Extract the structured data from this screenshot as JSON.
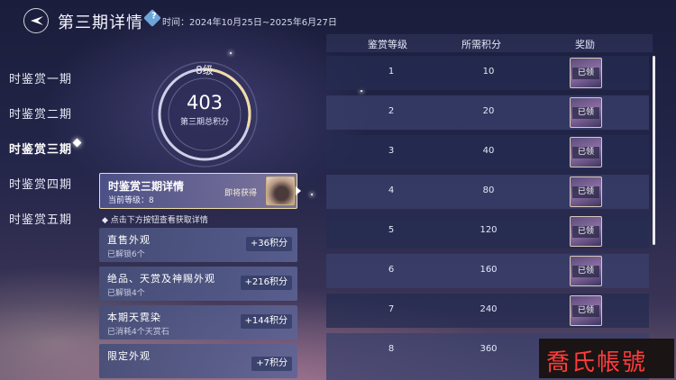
{
  "header": {
    "title": "第三期详情",
    "help_label": "?",
    "time": "时间：2024年10月25日~2025年6月27日"
  },
  "periods": [
    "时鉴赏一期",
    "时鉴赏二期",
    "时鉴赏三期",
    "时鉴赏四期",
    "时鉴赏五期"
  ],
  "active_period_index": 2,
  "progress": {
    "level": "8级",
    "score": "403",
    "label": "第三期总积分",
    "ring_fraction": 0.29
  },
  "detail_card": {
    "title": "时鉴赏三期详情",
    "current_level": "当前等级：8",
    "status": "即将获得"
  },
  "hint": "点击下方按钮查看获取详情",
  "categories": [
    {
      "title": "直售外观",
      "sub": "已解锁6个",
      "points": "+36积分"
    },
    {
      "title": "绝品、天赏及神赐外观",
      "sub": "已解锁4个",
      "points": "+216积分"
    },
    {
      "title": "本期天霓染",
      "sub": "已消耗4个天赏石",
      "points": "+144积分"
    },
    {
      "title": "限定外观",
      "sub": "",
      "points": "+7积分"
    }
  ],
  "table": {
    "headers": [
      "鉴赏等级",
      "所需积分",
      "奖励"
    ],
    "rows": [
      {
        "level": "1",
        "points": "10",
        "reward": "已领"
      },
      {
        "level": "2",
        "points": "20",
        "reward": "已领"
      },
      {
        "level": "3",
        "points": "40",
        "reward": "已领"
      },
      {
        "level": "4",
        "points": "80",
        "reward": "已领"
      },
      {
        "level": "5",
        "points": "120",
        "reward": "已领"
      },
      {
        "level": "6",
        "points": "160",
        "reward": "已领"
      },
      {
        "level": "7",
        "points": "240",
        "reward": "已领"
      },
      {
        "level": "8",
        "points": "360",
        "reward": ""
      }
    ]
  },
  "watermark": "喬氏帳號",
  "colors": {
    "accent_gold": "#f1dca6",
    "watermark_red": "#ff3b3b"
  }
}
